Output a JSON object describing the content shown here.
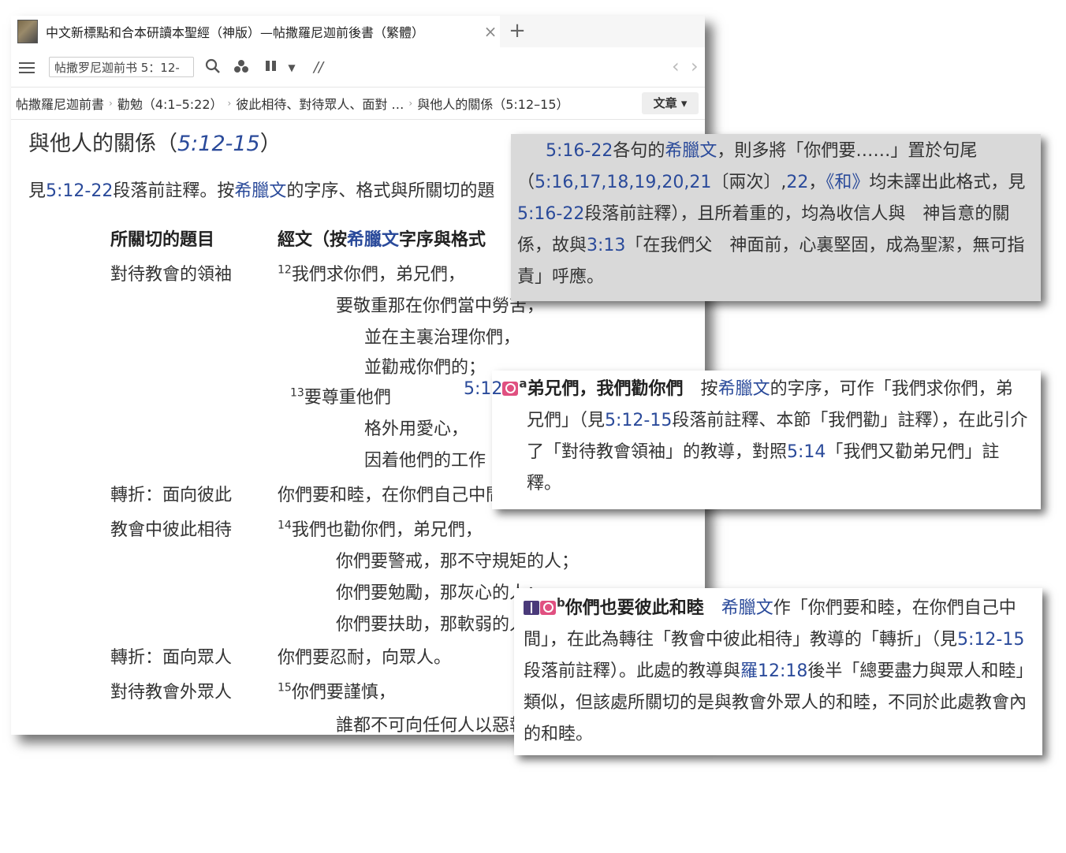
{
  "tab": {
    "title": "中文新標點和合本研讀本聖經（神版）—帖撒羅尼迦前後書（繁體）",
    "close": "×",
    "add": "+"
  },
  "toolbar": {
    "reference_value": "帖撒罗尼迦前书 5：12-",
    "parallel_symbol": "//",
    "back": "‹",
    "forward": "›"
  },
  "breadcrumb": {
    "items": [
      "帖撒羅尼迦前書",
      "勸勉（4:1–5:22）",
      "彼此相待、對待眾人、面對 …",
      "與他人的關係（5:12–15）"
    ],
    "mode_button": "文章 ▾"
  },
  "section": {
    "title_text": "與他人的關係（",
    "title_ref": "5:12-15",
    "title_close": "）"
  },
  "intro": {
    "pre": "見",
    "ref": "5:12-22",
    "mid": "段落前註釋。按",
    "greek": "希臘文",
    "post": "的字序、格式與所關切的題"
  },
  "table": {
    "header_topic": "所關切的題目",
    "header_text_pre": "經文（按",
    "header_text_greek": "希臘文",
    "header_text_post": "字序與格式",
    "topics": [
      "對待教會的領袖",
      "轉折：面向彼此",
      "教會中彼此相待",
      "轉折：面向眾人",
      "對待教會外眾人"
    ],
    "lines": [
      {
        "v": "12",
        "t": "我們求你們，弟兄們，"
      },
      {
        "v": "",
        "t": "要敬重那在你們當中勞苦，"
      },
      {
        "v": "",
        "t": "並在主裏治理你們，"
      },
      {
        "v": "",
        "t": "並勸戒你們的；"
      },
      {
        "v": "13",
        "t": "要尊重他們"
      },
      {
        "v": "",
        "t": "格外用愛心，"
      },
      {
        "v": "",
        "t": "因着他們的工作"
      },
      {
        "v": "",
        "t": "你們要和睦，在你們自己中間"
      },
      {
        "v": "14",
        "t": "我們也勸你們，弟兄們，"
      },
      {
        "v": "",
        "t": "你們要警戒，那不守規矩的人；"
      },
      {
        "v": "",
        "t": "你們要勉勵，那灰心的人；"
      },
      {
        "v": "",
        "t": "你們要扶助，那軟弱的人；"
      },
      {
        "v": "",
        "t": "你們要忍耐，向眾人。"
      },
      {
        "v": "15",
        "t": "你們要謹慎，"
      },
      {
        "v": "",
        "t": "誰都不可向任何人以惡報惡"
      }
    ]
  },
  "popup1": {
    "ref1": "5:16-22",
    "t1": "各句的",
    "greek": "希臘文",
    "t2": "，則多將「你們要……」置於句尾（",
    "refs2": "5:16,17,18,19,20,21",
    "t3": "〔兩次〕,",
    "ref3": "22",
    "t4": "，",
    "he": "《和》",
    "t5": "均未譯出此格式，見",
    "ref4": "5:16-22",
    "t6": "段落前註釋），且所着重的，均為收信人與　神旨意的關係，故與",
    "ref5": "3:13",
    "t7": "「在我們父　神面前，心裏堅固，成為聖潔，無可指責」呼應。"
  },
  "popup2": {
    "ref": "5:12",
    "sup": "a",
    "heading": "弟兄們，我們勸你們",
    "t1": "　按",
    "greek": "希臘文",
    "t2": "的字序，可作「我們求你們，弟兄們」（見",
    "ref2": "5:12-15",
    "t3": "段落前註釋、本節「我們勸」註釋），在此引介了「對待教會領袖」的教導，對照",
    "ref3": "5:14",
    "t4": "「我們又勸弟兄們」註釋。"
  },
  "popup3": {
    "sup": "b",
    "heading": "你們也要彼此和睦",
    "t1": "　",
    "greek": "希臘文",
    "t2": "作「你們要和睦，在你們自己中間」，在此為轉往「教會中彼此相待」教導的「轉折」（見",
    "ref2": "5:12-15",
    "t3": "段落前註釋）。此處的教導與",
    "ref3": "羅12:18",
    "t4": "後半「總要盡力與眾人和睦」類似，但該處所關切的是與教會外眾人的和睦，不同於此處教會內的和睦。"
  },
  "colors": {
    "link": "#2a4a9a",
    "popup_gray": "#d9d9d9",
    "magnifier_icon": "#e05080",
    "book_icon": "#4a3a7a"
  }
}
